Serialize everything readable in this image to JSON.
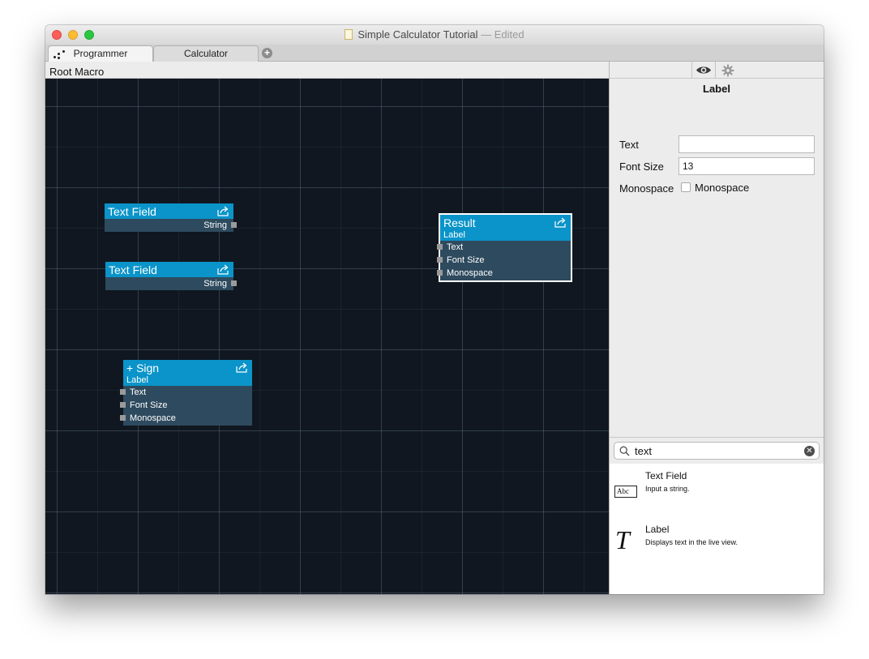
{
  "window": {
    "title": "Simple Calculator Tutorial",
    "title_sep": "—",
    "edited": "Edited"
  },
  "tabs": [
    {
      "label": "Programmer",
      "active": true
    },
    {
      "label": "Calculator",
      "active": false
    }
  ],
  "breadcrumb": "Root Macro",
  "canvas": {
    "nodes": [
      {
        "title": "Text Field",
        "outputs": [
          "String"
        ]
      },
      {
        "title": "Text Field",
        "outputs": [
          "String"
        ]
      },
      {
        "title": "+ Sign",
        "subtitle": "Label",
        "inputs": [
          "Text",
          "Font Size",
          "Monospace"
        ]
      },
      {
        "title": "Result",
        "subtitle": "Label",
        "inputs": [
          "Text",
          "Font Size",
          "Monospace"
        ],
        "selected": true
      }
    ]
  },
  "inspector": {
    "title": "Label",
    "fields": {
      "text_label": "Text",
      "text_value": "",
      "font_size_label": "Font Size",
      "font_size_value": "13",
      "monospace_label": "Monospace",
      "monospace_checkbox_label": "Monospace",
      "monospace_checked": false
    }
  },
  "library": {
    "search_value": "text",
    "items": [
      {
        "name": "Text Field",
        "description": "Input a string.",
        "icon": "abc-text-field-icon",
        "icon_text": "Abc"
      },
      {
        "name": "Label",
        "description": "Displays text in the live view.",
        "icon": "italic-t-icon",
        "icon_text": "T"
      }
    ]
  },
  "colors": {
    "canvas_bg": "#101720",
    "node_header": "#0a94c9",
    "node_body": "#2e4a5e"
  }
}
